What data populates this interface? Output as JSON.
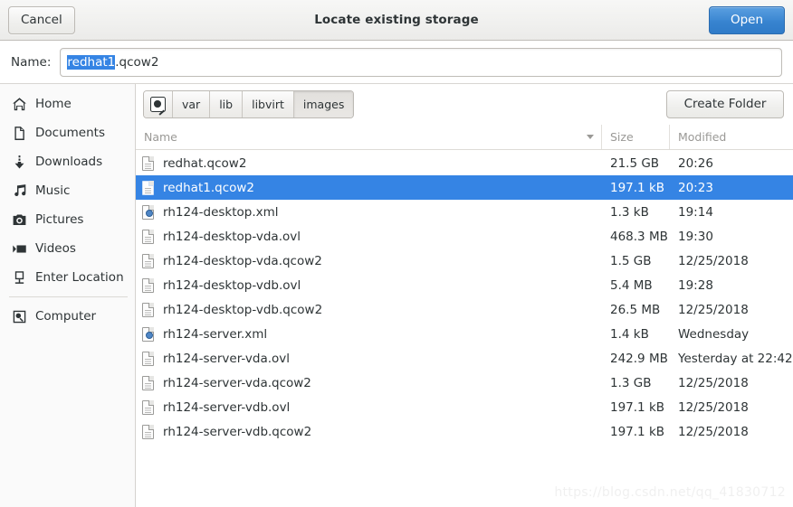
{
  "header": {
    "title": "Locate existing storage",
    "cancel_label": "Cancel",
    "open_label": "Open"
  },
  "name_row": {
    "label": "Name:",
    "value_selected": "redhat1",
    "value_rest": ".qcow2",
    "full_value": "redhat1.qcow2"
  },
  "sidebar": {
    "items": [
      {
        "label": "Home",
        "icon": "home-icon"
      },
      {
        "label": "Documents",
        "icon": "document-icon"
      },
      {
        "label": "Downloads",
        "icon": "download-icon"
      },
      {
        "label": "Music",
        "icon": "music-icon"
      },
      {
        "label": "Pictures",
        "icon": "camera-icon"
      },
      {
        "label": "Videos",
        "icon": "video-icon"
      },
      {
        "label": "Enter Location",
        "icon": "enter-location-icon"
      },
      {
        "label": "Computer",
        "icon": "computer-disk-icon"
      }
    ]
  },
  "pathbar": {
    "root_icon": "filesystem-disk-icon",
    "crumbs": [
      {
        "label": "var",
        "active": false
      },
      {
        "label": "lib",
        "active": false
      },
      {
        "label": "libvirt",
        "active": false
      },
      {
        "label": "images",
        "active": true
      }
    ],
    "create_folder_label": "Create Folder"
  },
  "columns": {
    "name": "Name",
    "size": "Size",
    "modified": "Modified",
    "sort_direction": "descending-arrow"
  },
  "files": [
    {
      "name": "redhat.qcow2",
      "size": "21.5 GB",
      "modified": "20:26",
      "icon": "file-icon",
      "selected": false
    },
    {
      "name": "redhat1.qcow2",
      "size": "197.1 kB",
      "modified": "20:23",
      "icon": "file-icon",
      "selected": true
    },
    {
      "name": "rh124-desktop.xml",
      "size": "1.3 kB",
      "modified": "19:14",
      "icon": "xml-file-icon",
      "selected": false
    },
    {
      "name": "rh124-desktop-vda.ovl",
      "size": "468.3 MB",
      "modified": "19:30",
      "icon": "file-icon",
      "selected": false
    },
    {
      "name": "rh124-desktop-vda.qcow2",
      "size": "1.5 GB",
      "modified": "12/25/2018",
      "icon": "file-icon",
      "selected": false
    },
    {
      "name": "rh124-desktop-vdb.ovl",
      "size": "5.4 MB",
      "modified": "19:28",
      "icon": "file-icon",
      "selected": false
    },
    {
      "name": "rh124-desktop-vdb.qcow2",
      "size": "26.5 MB",
      "modified": "12/25/2018",
      "icon": "file-icon",
      "selected": false
    },
    {
      "name": "rh124-server.xml",
      "size": "1.4 kB",
      "modified": "Wednesday",
      "icon": "xml-file-icon",
      "selected": false
    },
    {
      "name": "rh124-server-vda.ovl",
      "size": "242.9 MB",
      "modified": "Yesterday at 22:42",
      "icon": "file-icon",
      "selected": false
    },
    {
      "name": "rh124-server-vda.qcow2",
      "size": "1.3 GB",
      "modified": "12/25/2018",
      "icon": "file-icon",
      "selected": false
    },
    {
      "name": "rh124-server-vdb.ovl",
      "size": "197.1 kB",
      "modified": "12/25/2018",
      "icon": "file-icon",
      "selected": false
    },
    {
      "name": "rh124-server-vdb.qcow2",
      "size": "197.1 kB",
      "modified": "12/25/2018",
      "icon": "file-icon",
      "selected": false
    }
  ],
  "watermark": "https://blog.csdn.net/qq_41830712",
  "colors": {
    "selection_blue": "#3584e4",
    "open_button_blue": "#3884d0",
    "header_bg": "#ebebe9",
    "sidebar_bg": "#fafafa",
    "text": "#2e3436",
    "muted_text": "#9a9996"
  }
}
